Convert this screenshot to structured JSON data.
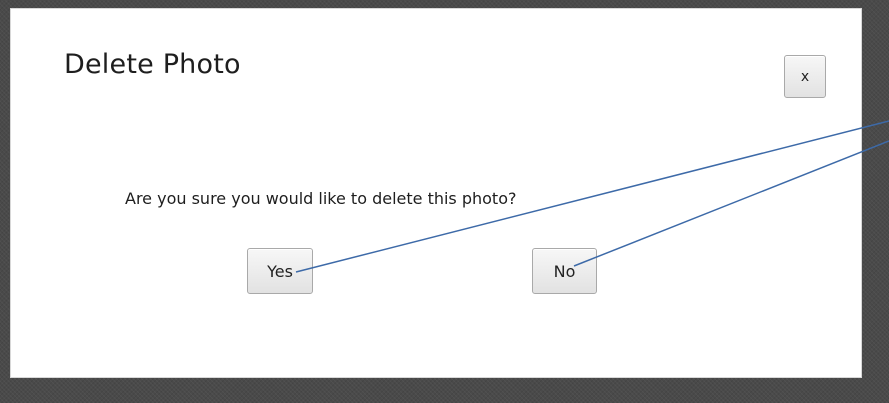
{
  "dialog": {
    "title": "Delete Photo",
    "close_label": "x",
    "message": "Are you sure you would like to delete this photo?",
    "yes_label": "Yes",
    "no_label": "No"
  },
  "colors": {
    "backdrop": "#4a4a4a",
    "dialog_background": "#ffffff",
    "annotation_line": "#3d6aa8"
  }
}
